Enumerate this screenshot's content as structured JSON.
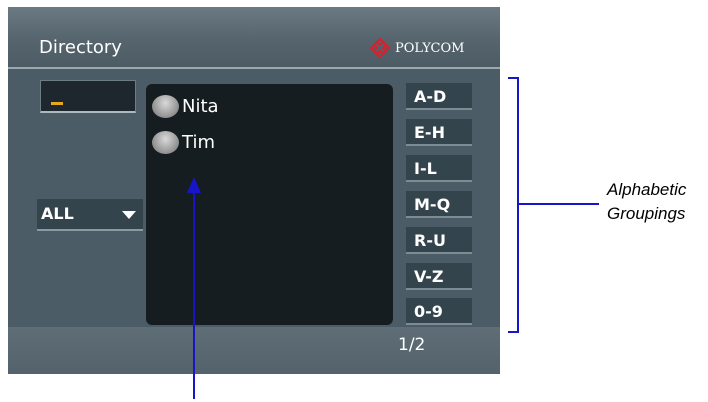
{
  "header": {
    "title": "Directory",
    "brand": "POLYCOM"
  },
  "dial_field": {
    "value": ""
  },
  "filter": {
    "label": "ALL"
  },
  "contacts": [
    {
      "name": "Nita"
    },
    {
      "name": "Tim"
    }
  ],
  "groups": [
    "A-D",
    "E-H",
    "I-L",
    "M-Q",
    "R-U",
    "V-Z",
    "0-9"
  ],
  "footer": {
    "page": "1/2"
  },
  "annotation": {
    "line1": "Alphabetic",
    "line2": "Groupings"
  },
  "colors": {
    "annotation": "#1616c8",
    "brand": "#d9202a",
    "cursor": "#e6a81e"
  }
}
